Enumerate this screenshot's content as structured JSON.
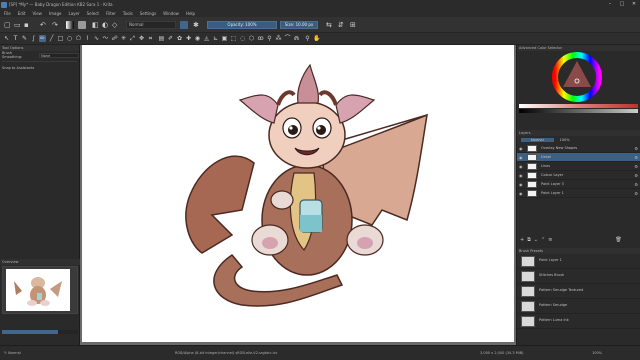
{
  "window": {
    "title": "[SP] *My* — Baby Dragon Edition KB2 Sara 1 - Krita",
    "controls": [
      "–",
      "□",
      "✕"
    ]
  },
  "menu": [
    "File",
    "Edit",
    "View",
    "Image",
    "Layer",
    "Select",
    "Filter",
    "Tools",
    "Settings",
    "Window",
    "Help"
  ],
  "toolbar": {
    "brush_preset": "Normal",
    "opacity_label": "Opacity: 100%",
    "size_label": "Size: 10.00 px"
  },
  "tool_options": {
    "title": "Tool Options",
    "row1_label": "Brush Smoothing:",
    "row1_value": "None",
    "row2_label": "Snap to Assistants"
  },
  "overview": {
    "title": "Overview"
  },
  "color_selector": {
    "title": "Advanced Color Selector"
  },
  "layers": {
    "title": "Layers",
    "blend_mode": "Normal",
    "opacity": "100%",
    "items": [
      {
        "name": "Overlay New Shapes",
        "active": false
      },
      {
        "name": "Detail",
        "active": true
      },
      {
        "name": "Lines",
        "active": false
      },
      {
        "name": "Colour Layer",
        "active": false
      },
      {
        "name": "Paint Layer 3",
        "active": false
      },
      {
        "name": "Paint Layer 1",
        "active": false
      }
    ]
  },
  "brush_presets": {
    "title": "Brush Presets",
    "items": [
      "Paint Layer 1",
      "Stitches Brush",
      "Pattern Smudge Textured",
      "Pattern Smudge",
      "Pattern Luma Ink"
    ]
  },
  "status": {
    "left": "RGB/Alpha (8-bit integer/channel)  sRGB-elle-V2-srgbtrc.icc",
    "center": "3,000 x 2,000 (34.3 MiB)",
    "right": "100%"
  },
  "colors": {
    "accent": "#41678e",
    "panel": "#2a2a2a",
    "canvas_bg": "#6b6b6b"
  }
}
